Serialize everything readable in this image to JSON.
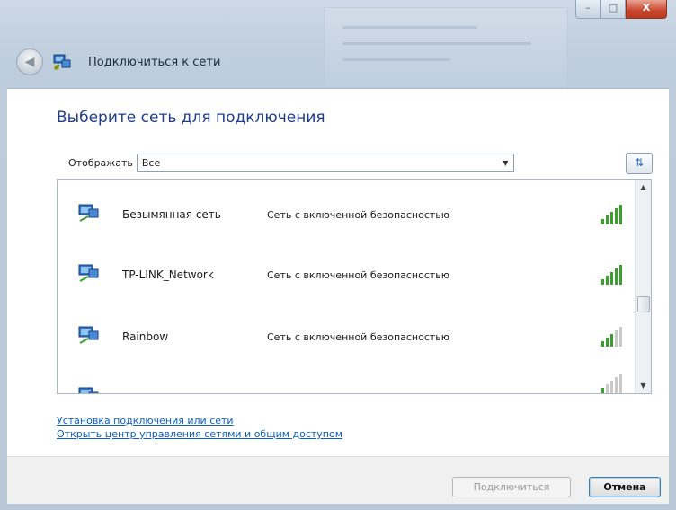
{
  "window": {
    "title": "Подключиться к сети",
    "controls": {
      "minimize": "–",
      "maximize": "□",
      "close": "X"
    }
  },
  "main": {
    "heading": "Выберите сеть для подключения",
    "filter": {
      "label": "Отображать",
      "selected": "Все"
    },
    "refresh_icon": "refresh-icon"
  },
  "networks": [
    {
      "name": "Безымянная сеть",
      "security": "Сеть с включенной безопасностью",
      "signal_bars": 5
    },
    {
      "name": "TP-LINK_Network",
      "security": "Сеть с включенной безопасностью",
      "signal_bars": 5
    },
    {
      "name": "Rainbow",
      "security": "Сеть с включенной безопасностью",
      "signal_bars": 3
    },
    {
      "name": "",
      "security": "",
      "signal_bars": 1
    }
  ],
  "links": {
    "setup": "Установка подключения или сети",
    "network_center": "Открыть центр управления сетями и общим доступом"
  },
  "footer": {
    "connect": "Подключиться",
    "cancel": "Отмена"
  },
  "colors": {
    "heading": "#1e3d8f",
    "link": "#0b5fc5",
    "signal_active": "#3aa02c",
    "signal_inactive": "#c9c9c9"
  }
}
